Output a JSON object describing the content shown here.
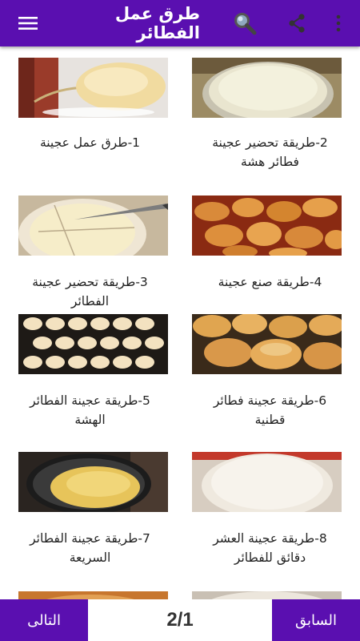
{
  "appbar": {
    "title": "طرق عمل الفطائر",
    "icons": [
      "more-vert-icon",
      "share-icon",
      "search-icon",
      "menu-icon"
    ]
  },
  "colors": {
    "primary": "#5a0fb0",
    "text": "#222222"
  },
  "recipes": [
    {
      "label": "1-طرق عمل عجينة"
    },
    {
      "label": "2-طريقة تحضير عجينة فطائر هشة"
    },
    {
      "label": "3-طريقة تحضير عجينة الفطائر"
    },
    {
      "label": "4-طريقة صنع عجينة"
    },
    {
      "label": "5-طريقة عجينة الفطائر الهشة"
    },
    {
      "label": "6-طريقة عجينة فطائر قطنية"
    },
    {
      "label": "7-طريقة عجينة الفطائر السريعة"
    },
    {
      "label": "8-طريقة عجينة العشر دقائق للفطائر"
    }
  ],
  "pagination": {
    "next_label": "التالى",
    "prev_label": "السابق",
    "page_indicator": "2/1"
  }
}
